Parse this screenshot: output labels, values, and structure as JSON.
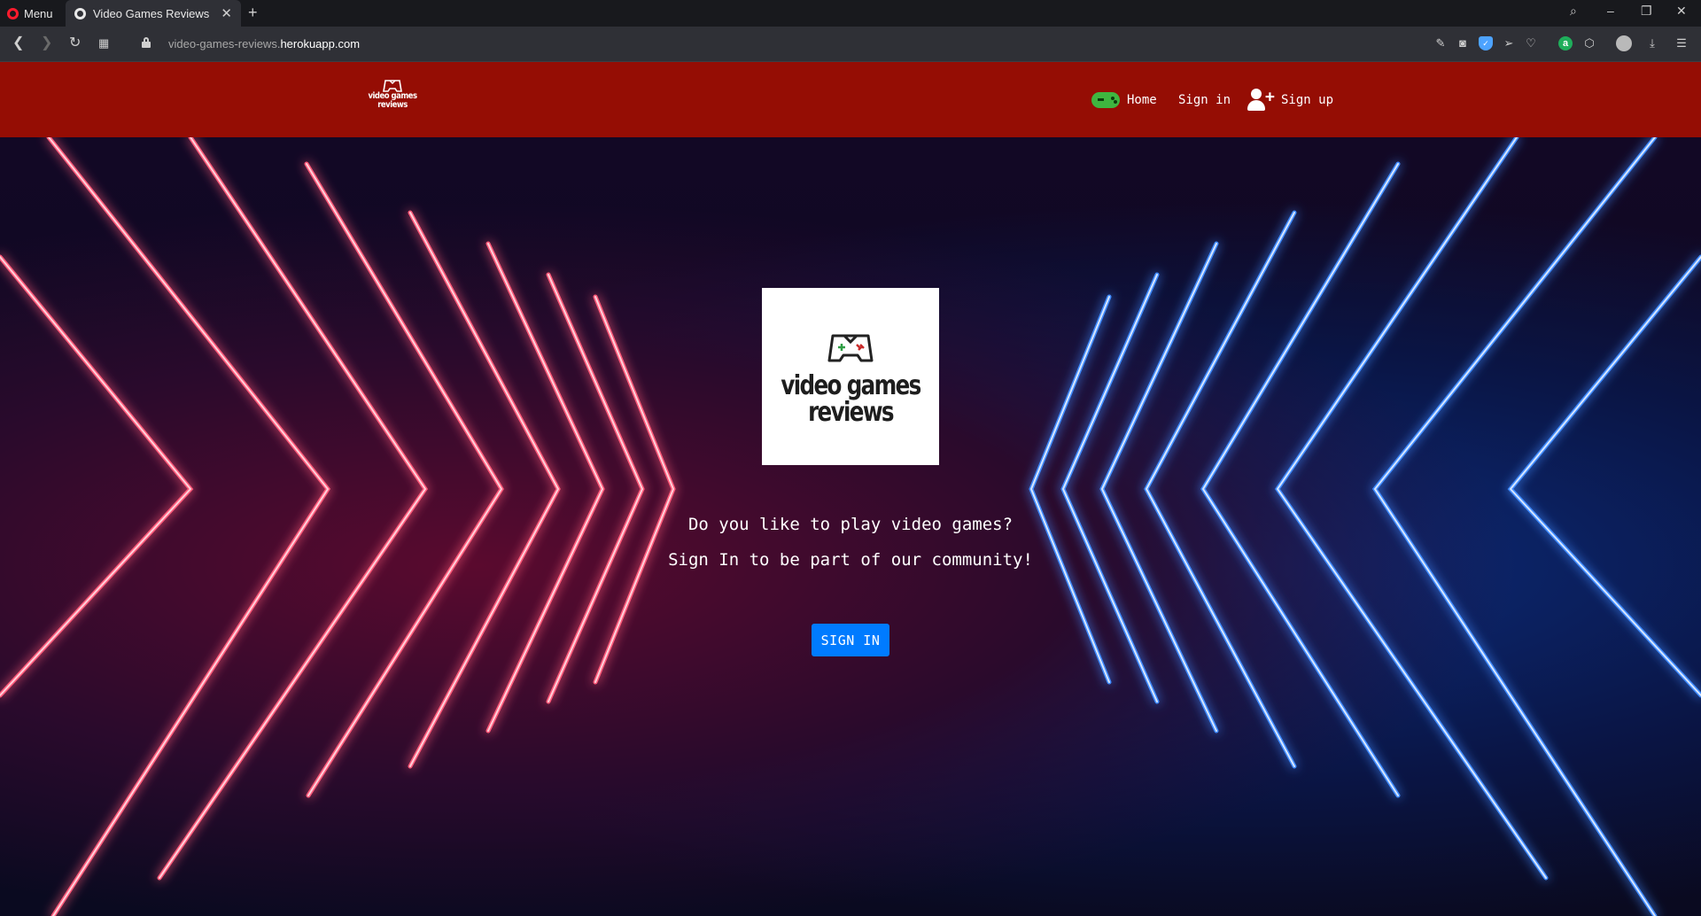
{
  "browser": {
    "menu_label": "Menu",
    "tab_title": "Video Games Reviews",
    "tab_close": "✕",
    "new_tab": "+",
    "url_prefix": "video-games-reviews.",
    "url_domain": "herokuapp.com"
  },
  "site": {
    "brand_line1": "video games",
    "brand_line2": "reviews",
    "nav": {
      "home": "Home",
      "sign_in": "Sign in",
      "sign_up": "Sign up"
    }
  },
  "hero": {
    "logo_line1": "video games",
    "logo_line2": "reviews",
    "line1": "Do you like to play video games?",
    "line2": "Sign In to be part of our community!",
    "cta": "SIGN IN"
  },
  "colors": {
    "header_red": "#950d04",
    "cta_blue": "#007bff",
    "neon_red": "#ff2d55",
    "neon_blue": "#2f7bff"
  }
}
